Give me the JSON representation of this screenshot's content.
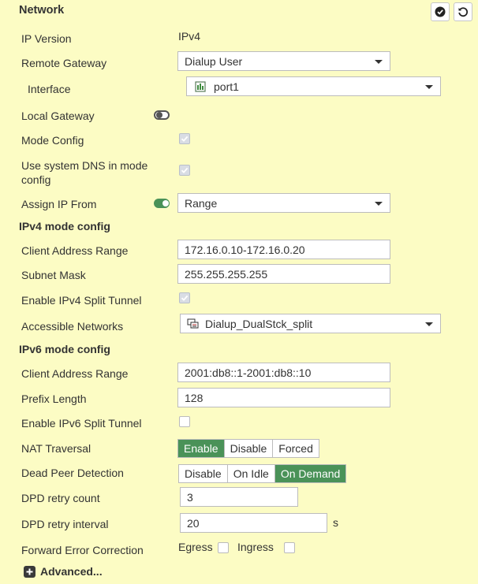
{
  "header": {
    "title": "Network"
  },
  "fields": {
    "ip_version": {
      "label": "IP Version",
      "value": "IPv4"
    },
    "remote_gateway": {
      "label": "Remote Gateway",
      "value": "Dialup User"
    },
    "interface": {
      "label": "Interface",
      "value": "port1"
    },
    "local_gateway": {
      "label": "Local Gateway",
      "enabled": false
    },
    "mode_config": {
      "label": "Mode Config",
      "checked": true
    },
    "use_system_dns": {
      "label_line1": "Use system DNS in mode",
      "label_line2": "config",
      "checked": true
    },
    "assign_ip_from": {
      "label": "Assign IP From",
      "enabled": true,
      "value": "Range"
    }
  },
  "ipv4": {
    "section": "IPv4 mode config",
    "client_range": {
      "label": "Client Address Range",
      "value": "172.16.0.10-172.16.0.20"
    },
    "subnet_mask": {
      "label": "Subnet Mask",
      "value": "255.255.255.255"
    },
    "split_tunnel": {
      "label": "Enable IPv4 Split Tunnel",
      "checked": true
    },
    "accessible_networks": {
      "label": "Accessible Networks",
      "value": "Dialup_DualStck_split"
    }
  },
  "ipv6": {
    "section": "IPv6 mode config",
    "client_range": {
      "label": "Client Address Range",
      "value": "2001:db8::1-2001:db8::10"
    },
    "prefix_length": {
      "label": "Prefix Length",
      "value": "128"
    },
    "split_tunnel": {
      "label": "Enable IPv6 Split Tunnel",
      "checked": false
    }
  },
  "nat_traversal": {
    "label": "NAT Traversal",
    "options": [
      "Enable",
      "Disable",
      "Forced"
    ],
    "selected": "Enable"
  },
  "dpd": {
    "label": "Dead Peer Detection",
    "options": [
      "Disable",
      "On Idle",
      "On Demand"
    ],
    "selected": "On Demand"
  },
  "dpd_retry_count": {
    "label": "DPD retry count",
    "value": "3"
  },
  "dpd_retry_interval": {
    "label": "DPD retry interval",
    "value": "20",
    "unit": "s"
  },
  "fec": {
    "label": "Forward Error Correction",
    "egress": "Egress",
    "ingress": "Ingress",
    "egress_checked": false,
    "ingress_checked": false
  },
  "advanced": {
    "label": "Advanced..."
  },
  "colors": {
    "accent": "#4a9258",
    "background": "#fcfcc4",
    "toggle_off": "#555555"
  }
}
